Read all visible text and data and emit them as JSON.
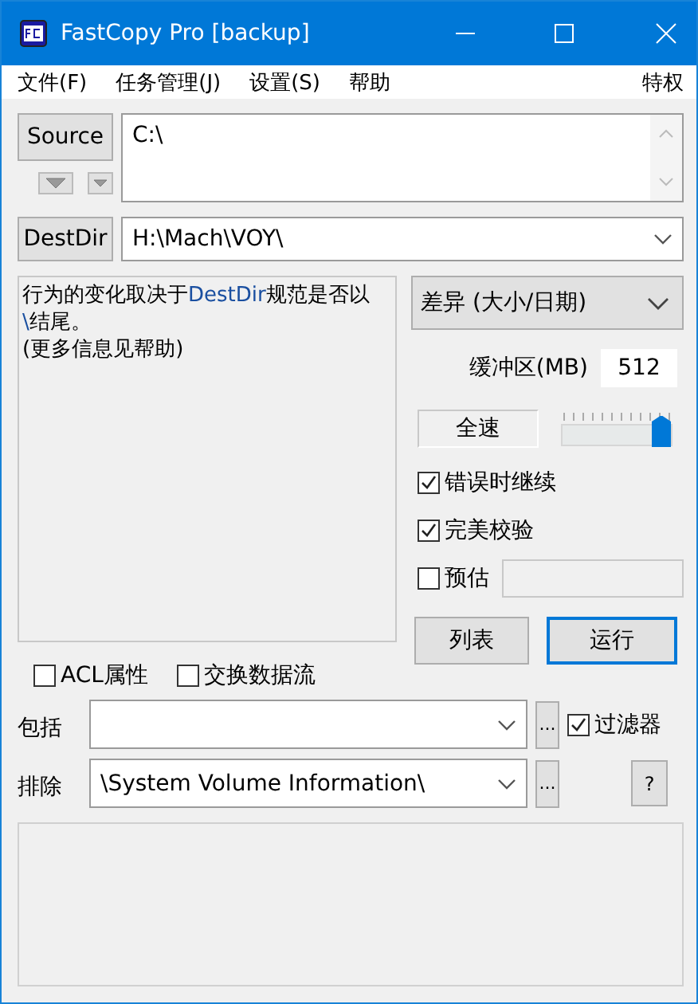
{
  "window": {
    "title": "FastCopy Pro [backup]"
  },
  "menu": [
    {
      "label": "文件(F)"
    },
    {
      "label": "任务管理(J)"
    },
    {
      "label": "设置(S)"
    },
    {
      "label": "帮助"
    }
  ],
  "menu_right": "特权",
  "source": {
    "button": "Source",
    "value": "C:\\"
  },
  "destdir": {
    "button": "DestDir",
    "value": "H:\\Mach\\VOY\\"
  },
  "info": [
    {
      "text": "行为的变化取决于",
      "highlight": false
    },
    {
      "text": "DestDir",
      "highlight": true
    },
    {
      "text": "规范是否以",
      "highlight": false
    },
    {
      "text": "\\",
      "highlight": true
    },
    {
      "text": "结尾。\n(更多信息见帮助)",
      "highlight": false
    }
  ],
  "mode": "差异 (大小/日期)",
  "buffer": {
    "label": "缓冲区(MB)",
    "value": "512"
  },
  "speed": {
    "label": "全速",
    "level": 1
  },
  "options": [
    {
      "label": "错误时继续",
      "checked": true,
      "kind": "plain"
    },
    {
      "label": "完美校验",
      "checked": true,
      "kind": "plain"
    },
    {
      "label": "预估",
      "checked": false,
      "kind": "with-field"
    }
  ],
  "buttons": [
    {
      "label": "列表",
      "default": false
    },
    {
      "label": "运行",
      "default": true
    }
  ],
  "attributes": [
    {
      "label": "ACL属性",
      "checked": false
    },
    {
      "label": "交换数据流",
      "checked": false
    }
  ],
  "filters": [
    {
      "label": "包括",
      "browse": "..."
    },
    {
      "label": "排除",
      "value": "\\System Volume Information\\",
      "browse": "..."
    }
  ],
  "filter_toggle": {
    "label": "过滤器",
    "checked": true
  },
  "help_button": "?"
}
